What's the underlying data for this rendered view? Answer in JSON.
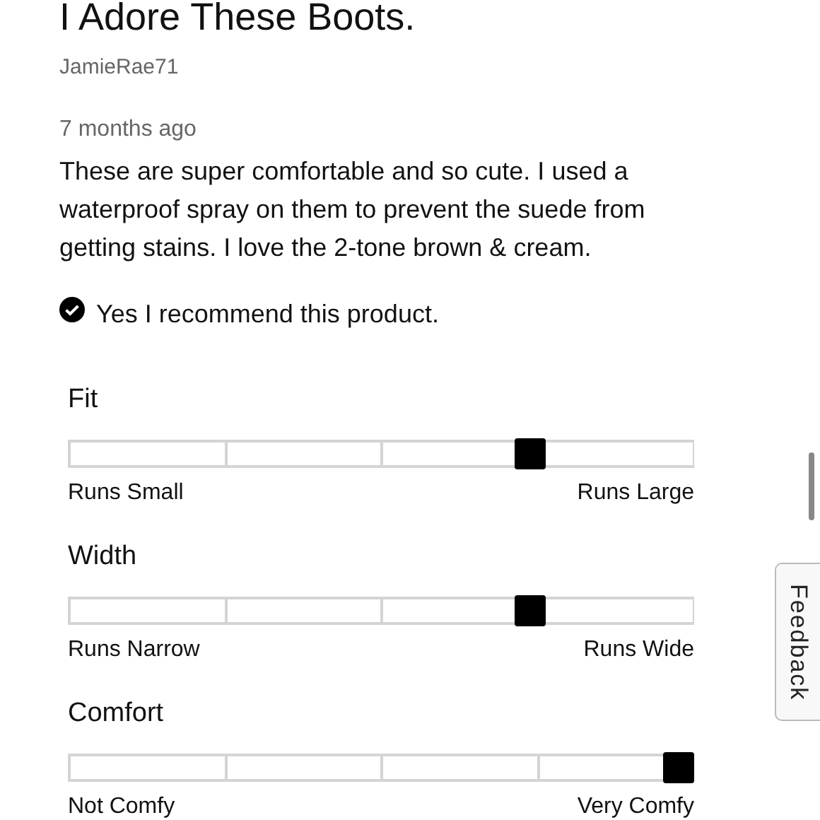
{
  "review": {
    "title": "I Adore These Boots.",
    "author": "JamieRae71",
    "time": "7 months ago",
    "body": "These are super comfortable and so cute. I used a waterproof spray on them to prevent the suede from getting stains. I love the 2-tone brown & cream.",
    "recommend": {
      "checked": true,
      "label": "Yes I recommend this product."
    }
  },
  "ratings": [
    {
      "name": "Fit",
      "level": 0.75,
      "low": "Runs Small",
      "high": "Runs Large"
    },
    {
      "name": "Width",
      "level": 0.75,
      "low": "Runs Narrow",
      "high": "Runs Wide"
    },
    {
      "name": "Comfort",
      "level": 1.0,
      "low": "Not Comfy",
      "high": "Very Comfy"
    }
  ],
  "feedback_tab": {
    "label": "Feedback"
  }
}
